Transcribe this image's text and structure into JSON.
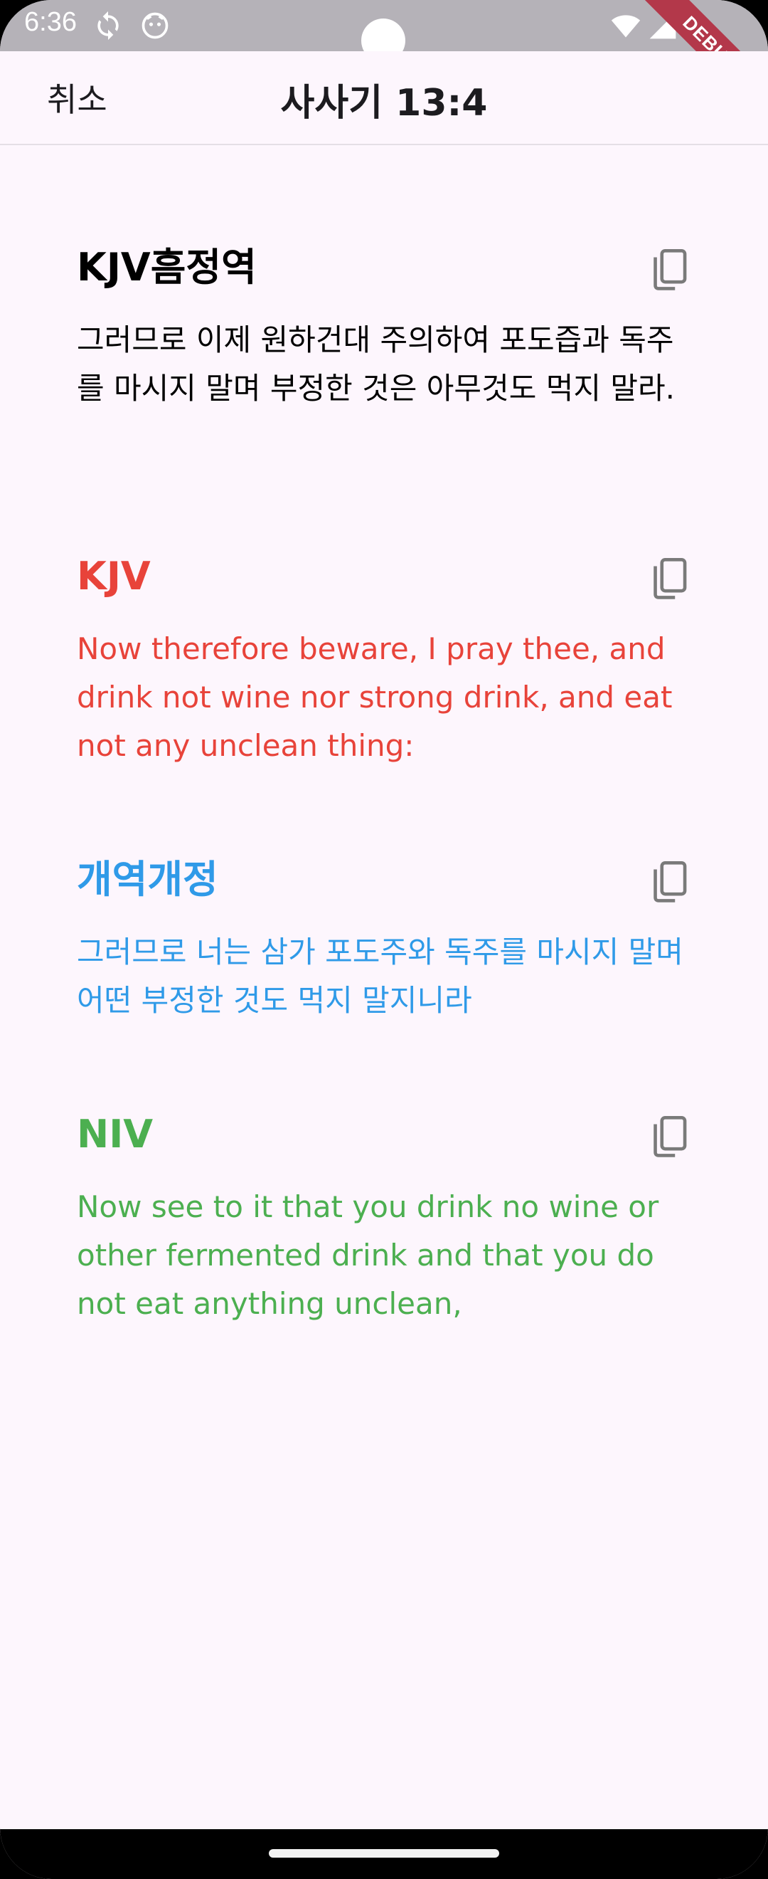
{
  "status_bar": {
    "time": "6:36",
    "icons": [
      "sync-icon",
      "face-icon",
      "wifi-icon",
      "signal-icon"
    ],
    "debug_label": "DEBUG"
  },
  "app_bar": {
    "cancel_label": "취소",
    "title": "사사기 13:4"
  },
  "translations": [
    {
      "name": "KJV흠정역",
      "text": "그러므로 이제 원하건대 주의하여 포도즙과 독주를 마시지 말며 부정한 것은 아무것도 먹지 말라.",
      "color": "#000000"
    },
    {
      "name": "KJV",
      "text": "Now therefore beware, I pray thee, and drink not wine nor strong drink, and eat not any unclean thing:",
      "color": "#e8433a"
    },
    {
      "name": "개역개정",
      "text": "그러므로 너는 삼가 포도주와 독주를 마시지 말며 어떤 부정한 것도 먹지 말지니라",
      "color": "#2f9ae8"
    },
    {
      "name": "NIV",
      "text": "Now see to it that you drink no wine or other fermented drink and that you do not eat anything unclean,",
      "color": "#4caf50"
    }
  ],
  "colors": {
    "background": "#fdf6fd",
    "status_bar": "#b5b2b8",
    "icon_gray": "#7a7a7a"
  }
}
